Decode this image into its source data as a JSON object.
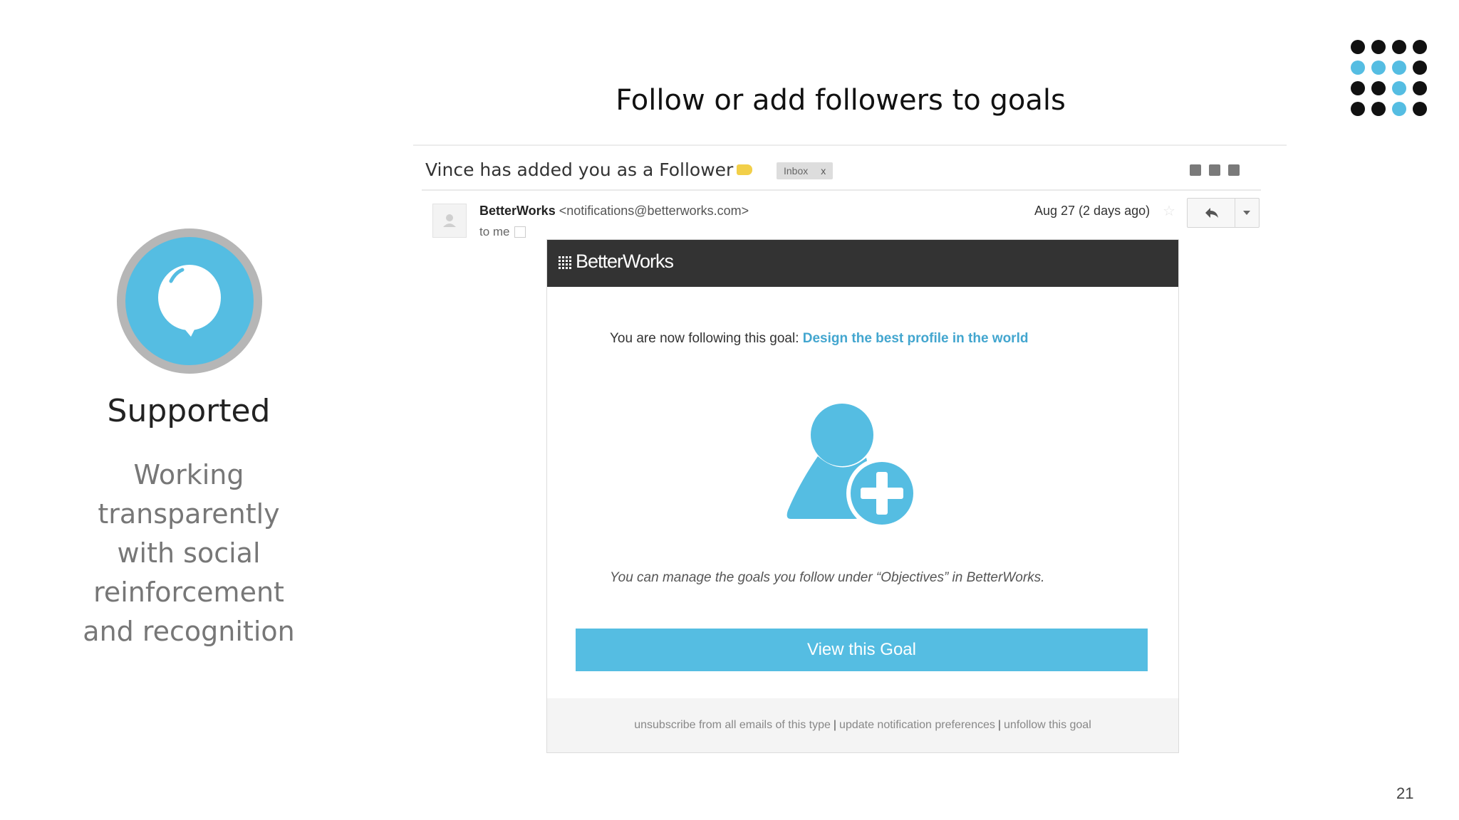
{
  "slide": {
    "title": "Follow or add followers to goals",
    "page_number": "21"
  },
  "badge": {
    "title": "Supported",
    "description": "Working\ntransparently\nwith social\nreinforcement\nand recognition",
    "icon": "balloon-icon",
    "colors": {
      "ring": "#b6b6b6",
      "fill": "#55bde2"
    }
  },
  "logo": {
    "rows": [
      [
        "black",
        "black",
        "black",
        "black"
      ],
      [
        "blue",
        "blue",
        "blue",
        "black"
      ],
      [
        "black",
        "black",
        "blue",
        "black"
      ],
      [
        "black",
        "black",
        "blue",
        "black"
      ]
    ],
    "colors": {
      "black": "#111111",
      "blue": "#55bde2"
    }
  },
  "email": {
    "subject": "Vince has added you as a Follower",
    "label": "Inbox",
    "label_close": "x",
    "toolbar_icons": [
      "archive-icon",
      "print-icon",
      "new-window-icon"
    ],
    "sender_name": "BetterWorks",
    "sender_email": "<notifications@betterworks.com>",
    "recipient": "to me",
    "date": "Aug 27 (2 days ago)",
    "body": {
      "brand": "BetterWorks",
      "follow_prefix": "You are now following this goal:",
      "goal_name": "Design the best profile in the world",
      "manage_note": "You can manage the goals you follow under “Objectives” in BetterWorks.",
      "cta_label": "View this Goal",
      "footer_links": [
        "unsubscribe from all emails of this type",
        "update notification preferences",
        "unfollow this goal"
      ],
      "accent_color": "#55bde2",
      "link_color": "#43a6cf"
    }
  }
}
